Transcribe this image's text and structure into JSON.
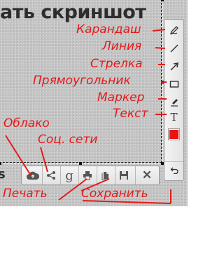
{
  "page": {
    "title_partial": "ать скриншот",
    "side_text": "s"
  },
  "tools": [
    {
      "name": "pencil-icon",
      "label": "Карандаш"
    },
    {
      "name": "line-icon",
      "label": "Линия"
    },
    {
      "name": "arrow-icon",
      "label": "Стрелка"
    },
    {
      "name": "rectangle-icon",
      "label": "Прямоугольник"
    },
    {
      "name": "marker-icon",
      "label": "Маркер"
    },
    {
      "name": "text-icon",
      "label": "Текст",
      "glyph": "T"
    }
  ],
  "color": {
    "selected": "#ee1111"
  },
  "bottom_tools": [
    {
      "name": "cloud-upload-icon"
    },
    {
      "name": "share-icon"
    },
    {
      "name": "google-icon",
      "glyph": "g"
    },
    {
      "name": "print-icon"
    },
    {
      "name": "copy-icon"
    },
    {
      "name": "save-icon"
    },
    {
      "name": "close-icon",
      "glyph": "✕"
    }
  ],
  "annotations": {
    "cloud": "Облако",
    "social": "Соц. сети",
    "print": "Печать",
    "save": "Сохранить"
  },
  "colors": {
    "annotation": "#e41a1a",
    "toolbar_border": "#9a9a9a"
  }
}
